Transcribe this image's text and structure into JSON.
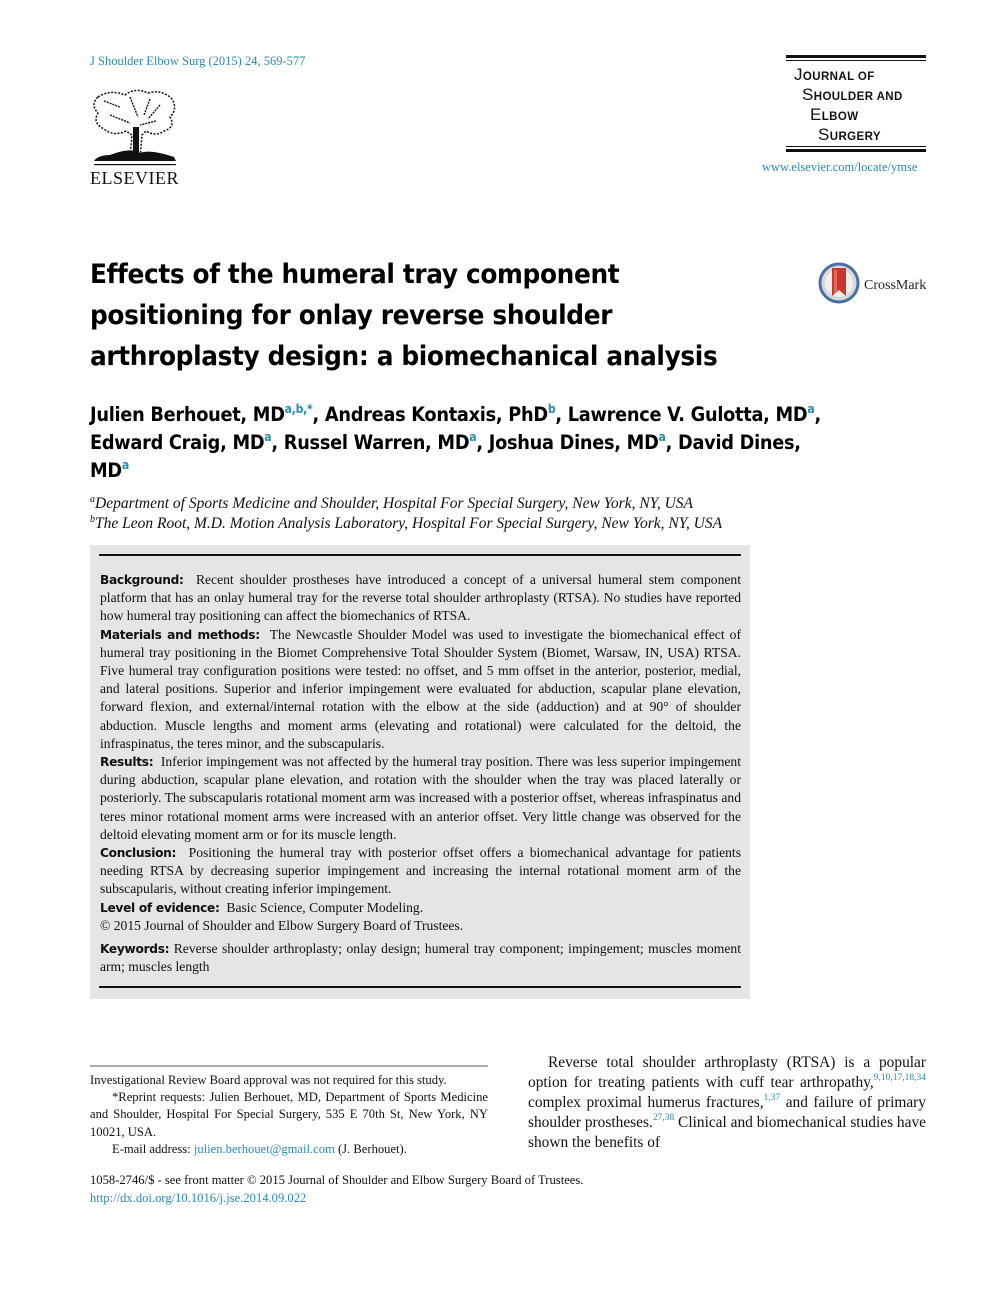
{
  "header": {
    "citation": "J Shoulder Elbow Surg (2015) 24, 569-577",
    "publisher_logo": "elsevier-tree-logo",
    "publisher_name": "ELSEVIER",
    "journal_logo_lines": [
      {
        "cap": "J",
        "rest": "OURNAL OF"
      },
      {
        "cap": "S",
        "rest": "HOULDER AND"
      },
      {
        "cap": "E",
        "rest": "LBOW"
      },
      {
        "cap": "S",
        "rest": "URGERY"
      }
    ],
    "journal_url": "www.elsevier.com/locate/ymse",
    "crossmark_label": "CrossMark"
  },
  "article": {
    "title": "Effects of the humeral tray component positioning for onlay reverse shoulder arthroplasty design: a biomechanical analysis",
    "authors": [
      {
        "name": "Julien Berhouet, MD",
        "aff": "a,b,*",
        "sep": ", "
      },
      {
        "name": "Andreas Kontaxis, PhD",
        "aff": "b",
        "sep": ", "
      },
      {
        "name": "Lawrence V. Gulotta, MD",
        "aff": "a",
        "sep": ","
      },
      {
        "name": "Edward Craig, MD",
        "aff": "a",
        "sep": ", "
      },
      {
        "name": "Russel Warren, MD",
        "aff": "a",
        "sep": ", "
      },
      {
        "name": "Joshua Dines, MD",
        "aff": "a",
        "sep": ", "
      },
      {
        "name": "David Dines, MD",
        "aff": "a",
        "sep": ""
      }
    ],
    "affiliations": [
      {
        "key": "a",
        "text": "Department of Sports Medicine and Shoulder, Hospital For Special Surgery, New York, NY, USA"
      },
      {
        "key": "b",
        "text": "The Leon Root, M.D. Motion Analysis Laboratory, Hospital For Special Surgery, New York, NY, USA"
      }
    ]
  },
  "abstract": {
    "sections": [
      {
        "label": "Background:",
        "text": "Recent shoulder prostheses have introduced a concept of a universal humeral stem component platform that has an onlay humeral tray for the reverse total shoulder arthroplasty (RTSA). No studies have reported how humeral tray positioning can affect the biomechanics of RTSA."
      },
      {
        "label": "Materials and methods:",
        "text": "The Newcastle Shoulder Model was used to investigate the biomechanical effect of humeral tray positioning in the Biomet Comprehensive Total Shoulder System (Biomet, Warsaw, IN, USA) RTSA. Five humeral tray configuration positions were tested: no offset, and 5 mm offset in the anterior, posterior, medial, and lateral positions. Superior and inferior impingement were evaluated for abduction, scapular plane elevation, forward flexion, and external/internal rotation with the elbow at the side (adduction) and at 90° of shoulder abduction. Muscle lengths and moment arms (elevating and rotational) were calculated for the deltoid, the infraspinatus, the teres minor, and the subscapularis."
      },
      {
        "label": "Results:",
        "text": "Inferior impingement was not affected by the humeral tray position. There was less superior impingement during abduction, scapular plane elevation, and rotation with the shoulder when the tray was placed laterally or posteriorly. The subscapularis rotational moment arm was increased with a posterior offset, whereas infraspinatus and teres minor rotational moment arms were increased with an anterior offset. Very little change was observed for the deltoid elevating moment arm or for its muscle length."
      },
      {
        "label": "Conclusion:",
        "text": "Positioning the humeral tray with posterior offset offers a biomechanical advantage for patients needing RTSA by decreasing superior impingement and increasing the internal rotational moment arm of the subscapularis, without creating inferior impingement."
      },
      {
        "label": "Level of evidence:",
        "text": "Basic Science, Computer Modeling."
      }
    ],
    "copyright": "© 2015 Journal of Shoulder and Elbow Surgery Board of Trustees.",
    "keywords_label": "Keywords:",
    "keywords": "Reverse shoulder arthroplasty; onlay design; humeral tray component; impingement; muscles moment arm; muscles length"
  },
  "footnotes": {
    "irb": "Investigational Review Board approval was not required for this study.",
    "reprint": "*Reprint requests: Julien Berhouet, MD, Department of Sports Medicine and Shoulder, Hospital For Special Surgery, 535 E 70th St, New York, NY 10021, USA.",
    "email_label": "E-mail address: ",
    "email": "julien.berhouet@gmail.com",
    "email_suffix": " (J. Berhouet)."
  },
  "body": {
    "segments": [
      {
        "text": "Reverse total shoulder arthroplasty (RTSA) is a popular option for treating patients with cuff tear arthropathy,"
      },
      {
        "ref": "9,10,17,18,34"
      },
      {
        "text": " complex proximal humerus fractures,"
      },
      {
        "ref": "1,37"
      },
      {
        "text": " and failure of primary shoulder prostheses."
      },
      {
        "ref": "27,38"
      },
      {
        "text": " Clinical and biomechanical studies have shown the benefits of"
      }
    ]
  },
  "footer": {
    "issn": "1058-2746/$ - see front matter © 2015 Journal of Shoulder and Elbow Surgery Board of Trustees.",
    "doi": "http://dx.doi.org/10.1016/j.jse.2014.09.022"
  }
}
